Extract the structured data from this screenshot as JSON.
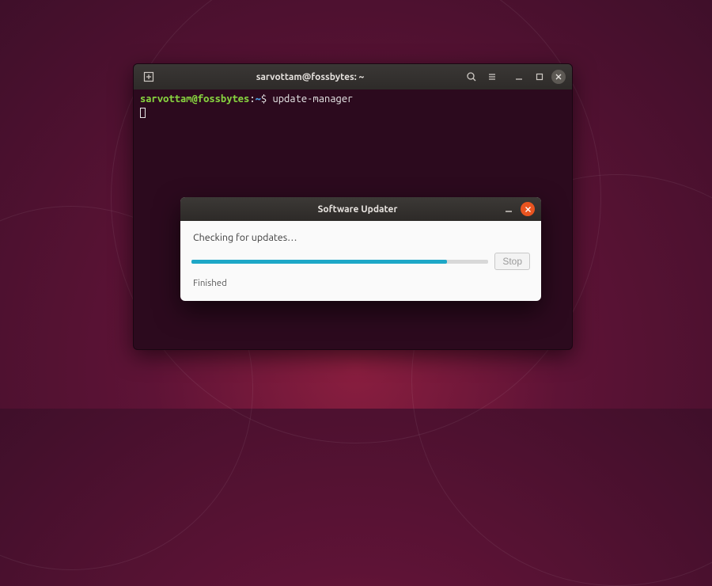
{
  "terminal": {
    "title": "sarvottam@fossbytes: ~",
    "prompt_user": "sarvottam",
    "prompt_at": "@",
    "prompt_host": "fossbytes",
    "prompt_sep": ":",
    "prompt_path": "~",
    "prompt_symbol": "$",
    "command": "update-manager"
  },
  "updater": {
    "title": "Software Updater",
    "heading": "Checking for updates…",
    "stop_label": "Stop",
    "status": "Finished"
  }
}
